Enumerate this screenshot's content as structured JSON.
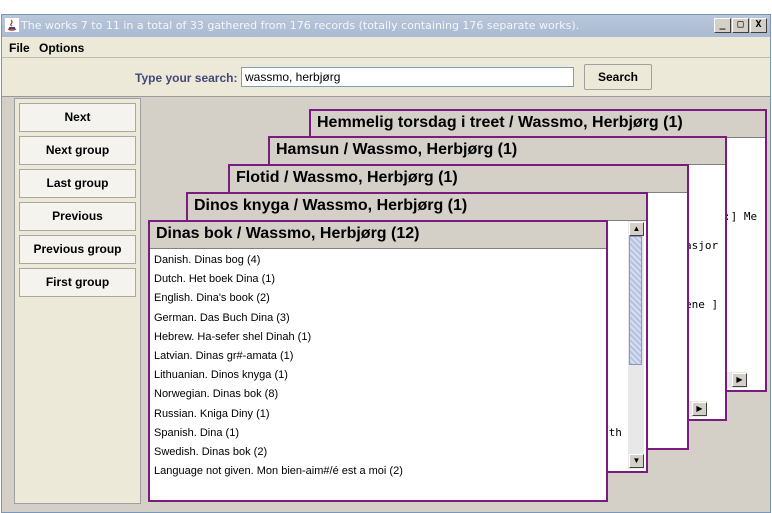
{
  "window": {
    "title": "The works 7 to 11 in a total of 33 gathered from 176 records (totally containing 176 separate works).",
    "buttons": {
      "minimize": "_",
      "maximize": "□",
      "close": "X"
    }
  },
  "menu": {
    "file": "File",
    "options": "Options"
  },
  "search": {
    "label": "Type your search:",
    "value": "wassmo, herbjørg",
    "button": "Search"
  },
  "nav": {
    "next": "Next",
    "next_group": "Next group",
    "last_group": "Last group",
    "previous": "Previous",
    "previous_group": "Previous group",
    "first_group": "First group"
  },
  "cards": [
    {
      "title": "Hemmelig torsdag i treet / Wassmo, Herbjørg (1)",
      "fragments": [
        ":] Me",
        "",
        ""
      ]
    },
    {
      "title": "Hamsun / Wassmo, Herbjørg (1)",
      "fragments": [
        "asjor",
        "ene ]"
      ]
    },
    {
      "title": "Flotid / Wassmo, Herbjørg (1)"
    },
    {
      "title": "Dinos knyga / Wassmo, Herbjørg (1)",
      "fragments": [
        "oth"
      ]
    },
    {
      "title": "Dinas bok / Wassmo, Herbjørg (12)",
      "items": [
        "Danish. Dinas bog (4)",
        "Dutch. Het boek Dina (1)",
        "English. Dina's book (2)",
        "German. Das Buch Dina (3)",
        "Hebrew. Ha-sefer shel Dinah (1)",
        "Latvian. Dinas gr#-amata (1)",
        "Lithuanian. Dinos knyga (1)",
        "Norwegian. Dinas bok (8)",
        "Russian. Kniga Diny (1)",
        "Spanish. Dina (1)",
        "Swedish. Dinas bok (2)",
        "Language not given. Mon bien-aim#/é est a moi (2)"
      ]
    }
  ]
}
